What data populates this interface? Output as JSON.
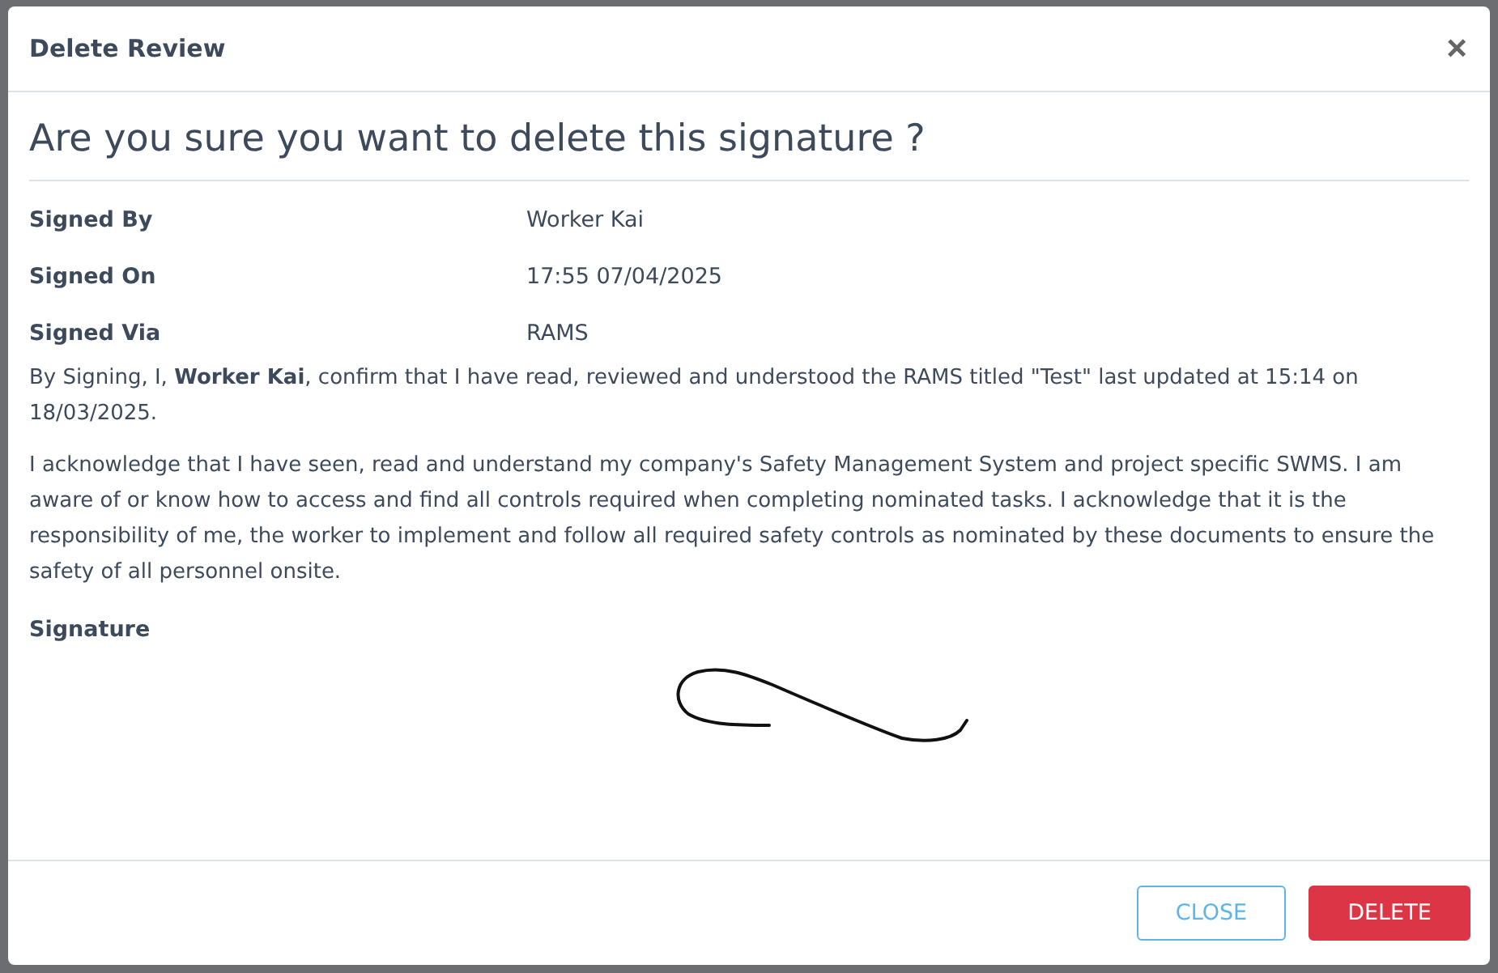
{
  "modal": {
    "title": "Delete Review",
    "close_icon": "×"
  },
  "question": "Are you sure you want to delete this signature ?",
  "fields": [
    {
      "label": "Signed By",
      "value": "Worker Kai"
    },
    {
      "label": "Signed On",
      "value": "17:55 07/04/2025"
    },
    {
      "label": "Signed Via",
      "value": "RAMS"
    }
  ],
  "paragraphs": [
    "By Signing, I, **Worker Kai**, confirm that I have read, reviewed and understood the RAMS titled \"Test\" last updated at 15:14 on 18/03/2025.",
    "I acknowledge that I have seen, read and understand my company's Safety Management System and project specific SWMS. I am aware of or know how to access and find all controls required when completing nominated tasks. I acknowledge that it is the responsibility of me, the worker to implement and follow all required safety controls as nominated by these documents to ensure the safety of all personnel onsite."
  ],
  "signature": {
    "label": "Signature"
  },
  "buttons": [
    {
      "kind": "outline",
      "label": "CLOSE"
    },
    {
      "kind": "danger",
      "label": "DELETE"
    }
  ]
}
